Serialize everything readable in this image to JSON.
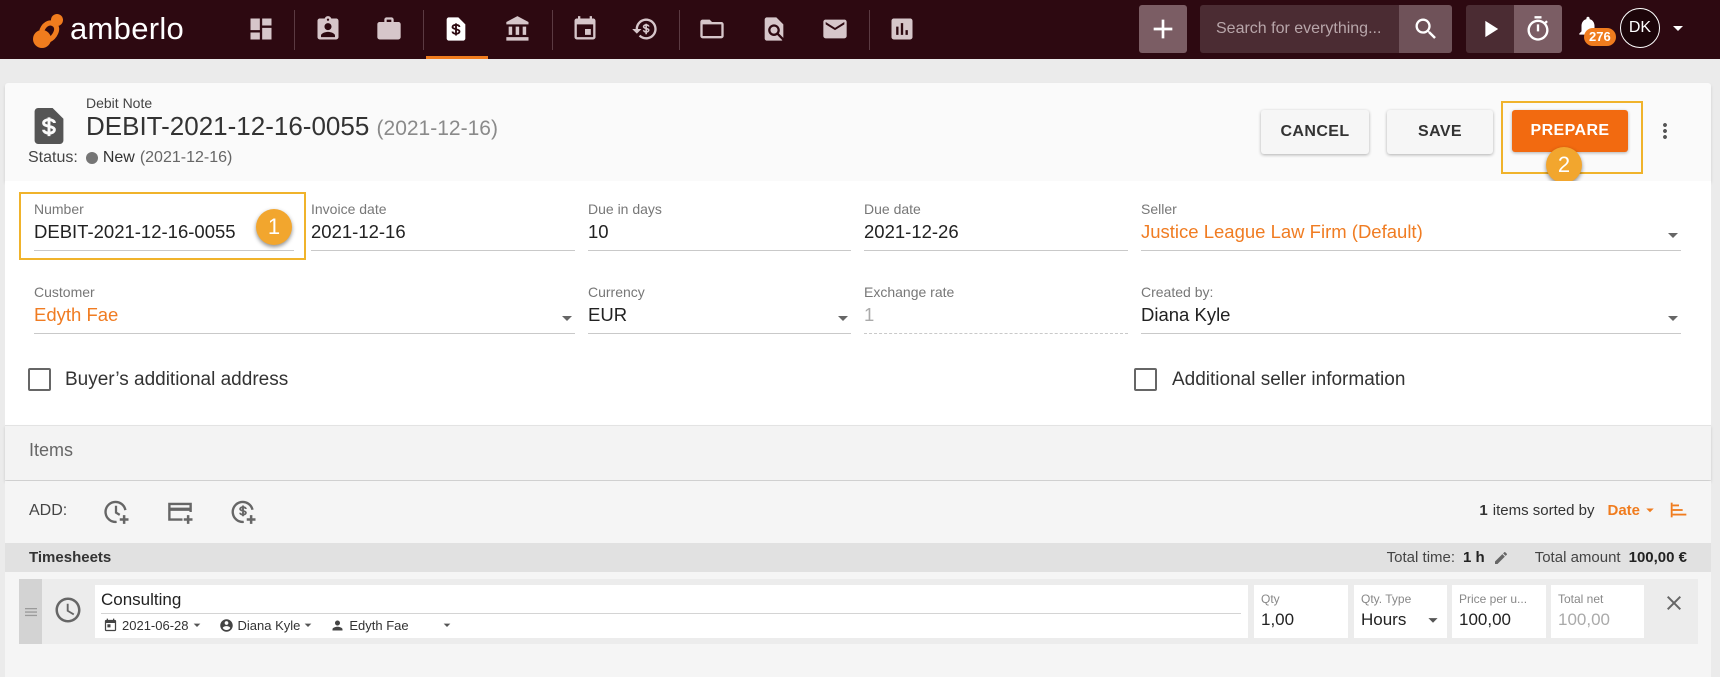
{
  "app": {
    "logo_text": "amberlo"
  },
  "nav": {
    "icons": [
      "dashboard-icon",
      "contacts-icon",
      "briefcase-icon",
      "debit-note-icon",
      "bank-icon",
      "calendar-icon",
      "time-billing-icon",
      "folder-icon",
      "document-search-icon",
      "mail-icon",
      "reports-icon"
    ],
    "active": "debit-note-icon"
  },
  "topbar": {
    "search_placeholder": "Search for everything...",
    "notification_count": "276",
    "avatar_initials": "DK"
  },
  "document": {
    "type_label": "Debit Note",
    "number": "DEBIT-2021-12-16-0055",
    "date": "(2021-12-16)",
    "status_label": "Status:",
    "status": "New",
    "status_date": "(2021-12-16)"
  },
  "actions": {
    "cancel": "CANCEL",
    "save": "SAVE",
    "prepare": "PREPARE"
  },
  "callouts": {
    "first": "1",
    "second": "2"
  },
  "form": {
    "number": {
      "label": "Number",
      "value": "DEBIT-2021-12-16-0055"
    },
    "invoice_date": {
      "label": "Invoice date",
      "value": "2021-12-16"
    },
    "due_in_days": {
      "label": "Due in days",
      "value": "10"
    },
    "due_date": {
      "label": "Due date",
      "value": "2021-12-26"
    },
    "seller": {
      "label": "Seller",
      "value": "Justice League Law Firm (Default)"
    },
    "customer": {
      "label": "Customer",
      "value": "Edyth Fae"
    },
    "currency": {
      "label": "Currency",
      "value": "EUR"
    },
    "exchange_rate": {
      "label": "Exchange rate",
      "value": "1"
    },
    "created_by": {
      "label": "Created by:",
      "value": "Diana Kyle"
    }
  },
  "options": {
    "buyer_address": {
      "label": "Buyer’s additional address",
      "checked": false
    },
    "seller_info": {
      "label": "Additional seller information",
      "checked": false
    }
  },
  "items": {
    "section_title": "Items",
    "add_label": "ADD:",
    "count": "1",
    "sorted_by_label": "items sorted by",
    "sort_field": "Date"
  },
  "timesheets": {
    "title": "Timesheets",
    "total_time_label": "Total time:",
    "total_time": "1 h",
    "total_amount_label": "Total amount",
    "total_amount": "100,00 €"
  },
  "entries": [
    {
      "description": "Consulting",
      "date": "2021-06-28",
      "user": "Diana Kyle",
      "client": "Edyth Fae",
      "qty_label": "Qty",
      "qty": "1,00",
      "qty_type_label": "Qty. Type",
      "qty_type": "Hours",
      "price_label": "Price per u...",
      "price": "100,00",
      "total_label": "Total net",
      "total": "100,00"
    }
  ],
  "colors": {
    "nav_bg": "#2d0911",
    "accent": "#f26a10",
    "link": "#f07c22",
    "callout": "#f0b32b"
  }
}
